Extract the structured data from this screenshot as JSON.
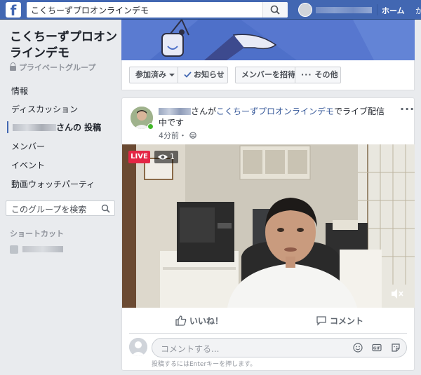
{
  "topbar": {
    "logo": "f",
    "search_value": "こくちーずプロオンラインデモ",
    "home_label": "ホーム",
    "more_label": "か"
  },
  "sidebar": {
    "group_name": "こくちーずプロオンラインデモ",
    "privacy_label": "プライベートグループ",
    "nav": {
      "info": "情報",
      "discussion": "ディスカッション",
      "your_posts_suffix": "さんの 投稿",
      "members": "メンバー",
      "events": "イベント",
      "watch_party": "動画ウォッチパーティ"
    },
    "search_placeholder": "このグループを検索",
    "shortcuts_title": "ショートカット"
  },
  "actions": {
    "joined": "参加済み",
    "notifications": "お知らせ",
    "invite": "メンバーを招待",
    "other": "その他"
  },
  "post": {
    "text_after_author": "さんが",
    "group_link": "こくちーずプロオンラインデモ",
    "text_end": "でライブ配信中です",
    "time": "4分前・",
    "live_badge": "LIVE",
    "viewer_count": "1",
    "like_label": "いいね！",
    "comment_label": "コメント",
    "comment_placeholder": "コメントする...",
    "comment_hint": "投稿するにはEnterキーを押します。"
  },
  "colors": {
    "brand": "#4267b2",
    "live": "#e42645",
    "online": "#42b72a",
    "link": "#365899"
  }
}
